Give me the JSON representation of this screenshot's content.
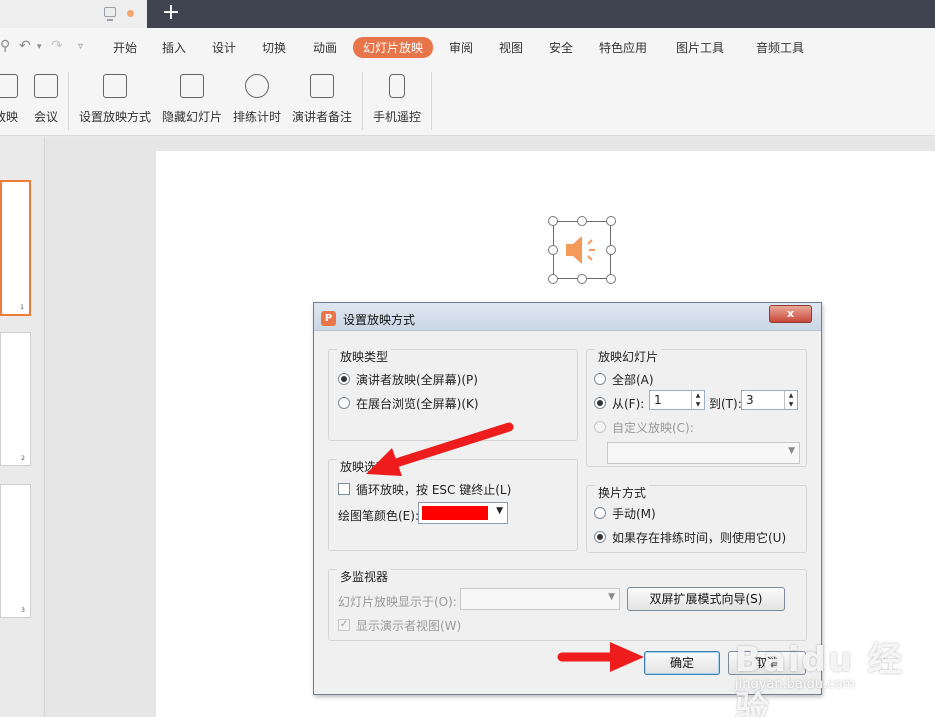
{
  "titlebar": {
    "new_tab_symbol": "+"
  },
  "menu": {
    "items": [
      "开始",
      "插入",
      "设计",
      "切换",
      "动画",
      "幻灯片放映",
      "审阅",
      "视图",
      "安全",
      "特色应用",
      "图片工具",
      "音频工具"
    ],
    "active": "幻灯片放映",
    "accent_color": "#e8744a"
  },
  "ribbon": {
    "buttons": [
      "放映",
      "会议",
      "设置放映方式",
      "隐藏幻灯片",
      "排练计时",
      "演讲者备注",
      "手机遥控"
    ]
  },
  "slides": {
    "page_numbers": [
      "1",
      "2",
      "3"
    ]
  },
  "dialog": {
    "title": "设置放映方式",
    "close_label": "x",
    "show_type": {
      "title": "放映类型",
      "options": [
        "演讲者放映(全屏幕)(P)",
        "在展台浏览(全屏幕)(K)"
      ],
      "selected": 0
    },
    "show_slides": {
      "title": "放映幻灯片",
      "all_label": "全部(A)",
      "from_label": "从(F):",
      "from_value": "1",
      "to_label": "到(T):",
      "to_value": "3",
      "custom_label": "自定义放映(C):"
    },
    "show_options": {
      "title": "放映选项",
      "loop_label": "循环放映，按 ESC 键终止(L)",
      "loop_checked": false,
      "pen_color_label": "绘图笔颜色(E):",
      "pen_color": "#ff0000"
    },
    "advance": {
      "title": "换片方式",
      "options": [
        "手动(M)",
        "如果存在排练时间，则使用它(U)"
      ],
      "selected": 1
    },
    "monitors": {
      "title": "多监视器",
      "display_label": "幻灯片放映显示于(O):",
      "wizard_button": "双屏扩展模式向导(S)",
      "presenter_view_label": "显示演示者视图(W)"
    },
    "ok_button": "确定",
    "cancel_button": "取消"
  },
  "annotations": {
    "arrow_color": "#ee1c1c"
  },
  "watermark": {
    "text": "Baidu 经验",
    "url": "jingyan.baidu.com"
  }
}
